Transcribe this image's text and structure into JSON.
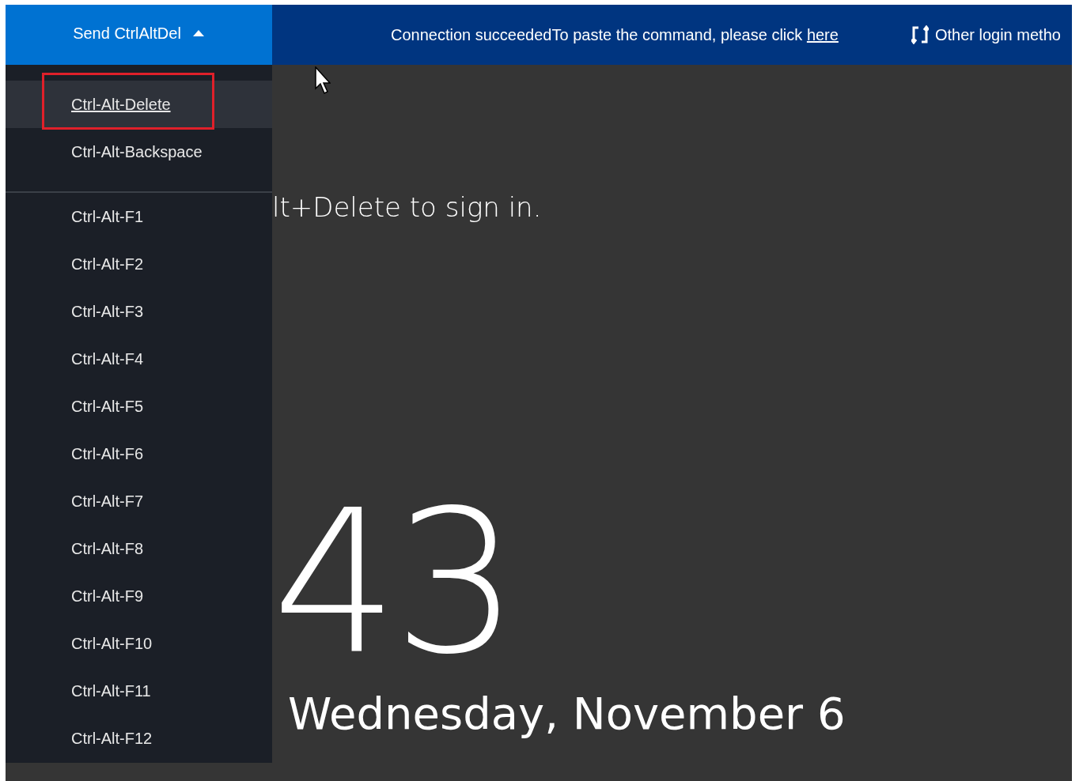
{
  "send_button": {
    "label": "Send CtrlAltDel",
    "expanded": true
  },
  "banner": {
    "text": "Connection succeededTo paste the command, please click",
    "link": "here"
  },
  "other_login": {
    "label": "Other login metho"
  },
  "menu": {
    "groups": [
      {
        "items": [
          {
            "label": "Ctrl-Alt-Delete",
            "selected": true
          },
          {
            "label": "Ctrl-Alt-Backspace",
            "selected": false
          }
        ]
      },
      {
        "items": [
          {
            "label": "Ctrl-Alt-F1",
            "selected": false
          },
          {
            "label": "Ctrl-Alt-F2",
            "selected": false
          },
          {
            "label": "Ctrl-Alt-F3",
            "selected": false
          },
          {
            "label": "Ctrl-Alt-F4",
            "selected": false
          },
          {
            "label": "Ctrl-Alt-F5",
            "selected": false
          },
          {
            "label": "Ctrl-Alt-F6",
            "selected": false
          },
          {
            "label": "Ctrl-Alt-F7",
            "selected": false
          },
          {
            "label": "Ctrl-Alt-F8",
            "selected": false
          },
          {
            "label": "Ctrl-Alt-F9",
            "selected": false
          },
          {
            "label": "Ctrl-Alt-F10",
            "selected": false
          },
          {
            "label": "Ctrl-Alt-F11",
            "selected": false
          },
          {
            "label": "Ctrl-Alt-F12",
            "selected": false
          }
        ]
      }
    ]
  },
  "lock_screen": {
    "sign_in_hint": "lt+Delete to sign in.",
    "time": "43",
    "date": "Wednesday, November 6"
  }
}
